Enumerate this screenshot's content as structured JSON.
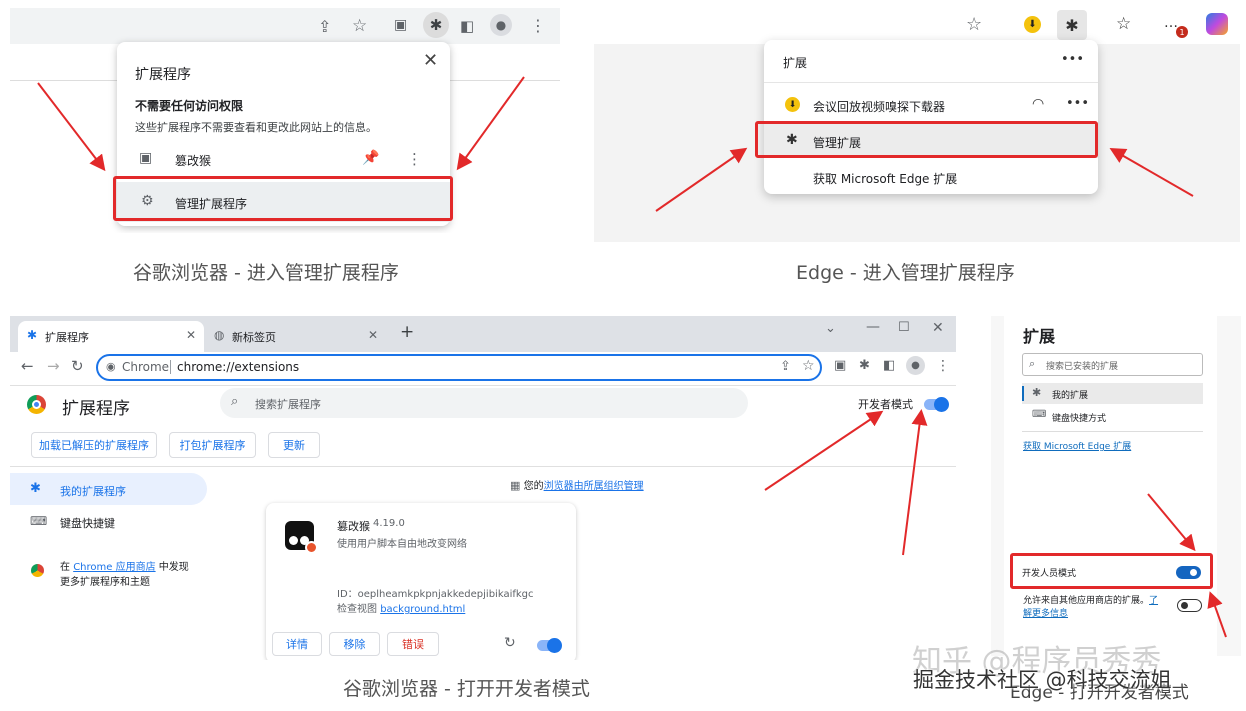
{
  "captions": {
    "chrome_manage": "谷歌浏览器 - 进入管理扩展程序",
    "edge_manage": "Edge - 进入管理扩展程序",
    "chrome_dev": "谷歌浏览器 - 打开开发者模式",
    "edge_dev": "Edge - 打开开发者模式"
  },
  "chrome_popup": {
    "title": "扩展程序",
    "section_title": "不需要任何访问权限",
    "section_desc": "这些扩展程序不需要查看和更改此网站上的信息。",
    "ext_name": "篡改猴",
    "manage_label": "管理扩展程序"
  },
  "edge_popup": {
    "title": "扩展",
    "ext_name": "会议回放视频嗅探下载器",
    "manage_label": "管理扩展",
    "get_label": "获取 Microsoft Edge 扩展",
    "badge": "1"
  },
  "chrome_ext_page": {
    "tab1": "扩展程序",
    "tab2": "新标签页",
    "new_tab": "+",
    "url_prefix": "Chrome",
    "url": "chrome://extensions",
    "page_title": "扩展程序",
    "search_placeholder": "搜索扩展程序",
    "dev_mode": "开发者模式",
    "btn_load": "加载已解压的扩展程序",
    "btn_pack": "打包扩展程序",
    "btn_update": "更新",
    "side_my": "我的扩展程序",
    "side_shortcuts": "键盘快捷键",
    "side_store_pre": "在 ",
    "side_store_link": "Chrome 应用商店",
    "side_store_post": " 中发现",
    "side_store_line2": "更多扩展程序和主题",
    "managed_pre": "您的",
    "managed_link": "浏览器由所属组织管理",
    "card_name": "篡改猴",
    "card_version": "4.19.0",
    "card_desc": "使用用户脚本自由地改变网络",
    "card_id": "ID：oeplheamkpkpnjakkedepjibikaifkgc",
    "card_view_pre": "检查视图 ",
    "card_view_link": "background.html",
    "card_details": "详情",
    "card_remove": "移除",
    "card_errors": "错误"
  },
  "edge_ext_page": {
    "title": "扩展",
    "search_placeholder": "搜索已安装的扩展",
    "nav_my": "我的扩展",
    "nav_shortcuts": "键盘快捷方式",
    "get_link": "获取 Microsoft Edge 扩展",
    "dev_mode": "开发人员模式",
    "allow_text": "允许来自其他应用商店的扩展。",
    "allow_link": "了",
    "learn_more": "解更多信息"
  },
  "watermarks": {
    "zhihu": "知乎 @程序员秀秀",
    "juejin": "掘金技术社区 @科技交流姐"
  },
  "colors": {
    "highlight_red": "#e2292a",
    "accent_blue": "#1a73e8",
    "edge_toggle": "#1565c0"
  }
}
